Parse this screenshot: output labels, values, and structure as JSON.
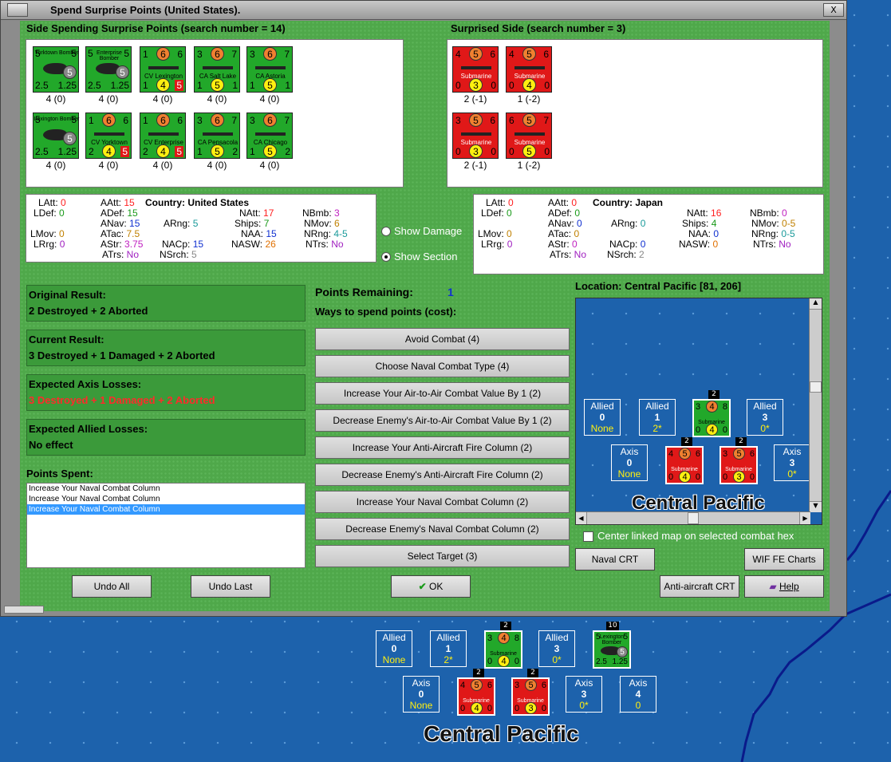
{
  "window": {
    "title": "Spend Surprise Points (United States).",
    "close": "X"
  },
  "side_spending": {
    "label": "Side Spending Surprise Points (search number = 14)",
    "counters": [
      {
        "kind": "air",
        "name": "Yorktown Bomber",
        "tl": "5",
        "tr": "5",
        "bl": "2.5",
        "br": "1.25",
        "mid": "5",
        "count": "4 (0)"
      },
      {
        "kind": "air",
        "name": "Enterprise Bomber",
        "tl": "5",
        "tr": "5",
        "bl": "2.5",
        "br": "1.25",
        "mid": "5",
        "count": "4 (0)"
      },
      {
        "kind": "ship",
        "name": "CV Lexington",
        "tl": "1",
        "top": "6",
        "tr": "6",
        "bl": "1",
        "bot": "4",
        "br": "5",
        "count": "4 (0)"
      },
      {
        "kind": "ship",
        "name": "CA Salt Lake City",
        "tl": "3",
        "top": "6",
        "tr": "7",
        "bl": "1",
        "bot": "5",
        "br": "1",
        "count": "4 (0)"
      },
      {
        "kind": "ship",
        "name": "CA Astoria",
        "tl": "3",
        "top": "6",
        "tr": "7",
        "bl": "1",
        "bot": "5",
        "br": "1",
        "count": "4 (0)"
      },
      {
        "kind": "air",
        "name": "Lexington Bomber",
        "tl": "5",
        "tr": "5",
        "bl": "2.5",
        "br": "1.25",
        "mid": "5",
        "count": "4 (0)"
      },
      {
        "kind": "ship",
        "name": "CV Yorktown",
        "tl": "1",
        "top": "6",
        "tr": "6",
        "bl": "2",
        "bot": "4",
        "br": "5",
        "count": "4 (0)"
      },
      {
        "kind": "ship",
        "name": "CV Enterprise",
        "tl": "1",
        "top": "6",
        "tr": "6",
        "bl": "2",
        "bot": "4",
        "br": "5",
        "count": "4 (0)"
      },
      {
        "kind": "ship",
        "name": "CA Pensacola",
        "tl": "3",
        "top": "6",
        "tr": "7",
        "bl": "1",
        "bot": "5",
        "br": "2",
        "count": "4 (0)"
      },
      {
        "kind": "ship",
        "name": "CA Chicago",
        "tl": "3",
        "top": "6",
        "tr": "7",
        "bl": "1",
        "bot": "5",
        "br": "2",
        "count": "4 (0)"
      }
    ]
  },
  "surprised_side": {
    "label": "Surprised Side (search number = 3)",
    "counters": [
      {
        "name": "Submarine",
        "tl": "4",
        "top": "5",
        "tr": "6",
        "bl": "0",
        "bot": "3",
        "br": "0",
        "count": "2 (-1)"
      },
      {
        "name": "Submarine",
        "tl": "4",
        "top": "5",
        "tr": "6",
        "bl": "0",
        "bot": "4",
        "br": "0",
        "count": "1 (-2)"
      },
      {
        "name": "Submarine",
        "tl": "3",
        "top": "5",
        "tr": "6",
        "bl": "0",
        "bot": "3",
        "br": "0",
        "count": "2 (-1)"
      },
      {
        "name": "Submarine",
        "tl": "6",
        "top": "5",
        "tr": "7",
        "bl": "0",
        "bot": "5",
        "br": "0",
        "count": "1 (-2)"
      }
    ]
  },
  "stats_us": {
    "country_label": "Country:",
    "country": "United States",
    "LAtt": "0",
    "LDef": "0",
    "LMov": "0",
    "LRrg": "0",
    "AAtt": "15",
    "ADef": "15",
    "ANav": "15",
    "ATac": "7.5",
    "AStr": "3.75",
    "ATrs": "No",
    "ARng": "5",
    "NACp": "15",
    "NSrch": "5",
    "NAtt": "17",
    "Ships": "7",
    "NAA": "15",
    "NASW": "26",
    "NBmb": "3",
    "NMov": "6",
    "NRng": "4-5",
    "NTrs": "No"
  },
  "stats_jp": {
    "country_label": "Country:",
    "country": "Japan",
    "LAtt": "0",
    "LDef": "0",
    "LMov": "0",
    "LRrg": "0",
    "AAtt": "0",
    "ADef": "0",
    "ANav": "0",
    "ATac": "0",
    "AStr": "0",
    "ATrs": "No",
    "ARng": "0",
    "NACp": "0",
    "NSrch": "2",
    "NAtt": "16",
    "Ships": "4",
    "NAA": "0",
    "NASW": "0",
    "NBmb": "0",
    "NMov": "0-5",
    "NRng": "0-5",
    "NTrs": "No"
  },
  "show_damage": "Show Damage",
  "show_section": "Show Section",
  "results": [
    {
      "title": "Original Result:",
      "value": "2 Destroyed + 2 Aborted",
      "color": "#000000"
    },
    {
      "title": "Current Result:",
      "value": "3 Destroyed + 1 Damaged + 2 Aborted",
      "color": "#000000"
    },
    {
      "title": "Expected Axis Losses:",
      "value": "3 Destroyed + 1 Damaged + 2 Aborted",
      "color": "#ff2a2a"
    },
    {
      "title": "Expected Allied Losses:",
      "value": "No effect",
      "color": "#000000"
    }
  ],
  "points_spent_label": "Points Spent:",
  "points_spent": [
    "Increase Your Naval Combat Column",
    "Increase Your Naval Combat Column",
    "Increase Your Naval Combat Column"
  ],
  "points_remaining_label": "Points Remaining:",
  "points_remaining": "1",
  "ways_label": "Ways to spend points (cost):",
  "ways": [
    "Avoid Combat (4)",
    "Choose Naval Combat Type (4)",
    "Increase Your Air-to-Air Combat Value By 1 (2)",
    "Decrease Enemy's Air-to-Air Combat Value By 1 (2)",
    "Increase Your Anti-Aircraft Fire Column (2)",
    "Decrease Enemy's Anti-Aircraft Fire Column (2)",
    "Increase Your Naval Combat Column (2)",
    "Decrease Enemy's Naval Combat Column (2)",
    "Select Target (3)"
  ],
  "location_label": "Location: Central Pacific [81, 206]",
  "map_name": "Central Pacific",
  "center_linked": "Center linked map on selected combat hex",
  "buttons": {
    "undo_all": "Undo All",
    "undo_last": "Undo Last",
    "ok": "OK",
    "naval_crt": "Naval CRT",
    "wif_charts": "WIF FE Charts",
    "aa_crt": "Anti-aircraft CRT",
    "help": "Help"
  },
  "map_boxes": {
    "allied": "Allied",
    "axis": "Axis",
    "v0": "0",
    "v1": "1",
    "v3": "3",
    "v4": "4",
    "none": "None",
    "two_star": "2*",
    "zero_star": "0*",
    "zero": "0"
  },
  "map_counters": {
    "sub": "Submarine",
    "g": [
      "3",
      "4",
      "8",
      "0",
      "4",
      "0"
    ],
    "r1": [
      "4",
      "5",
      "6",
      "0",
      "4",
      "0"
    ],
    "r2": [
      "3",
      "5",
      "6",
      "0",
      "3",
      "0"
    ],
    "stack2": "2",
    "stack10": "10",
    "bomber": "Lexington Bomber",
    "b": [
      "5",
      "5",
      "2.5",
      "1.25",
      "5"
    ]
  }
}
